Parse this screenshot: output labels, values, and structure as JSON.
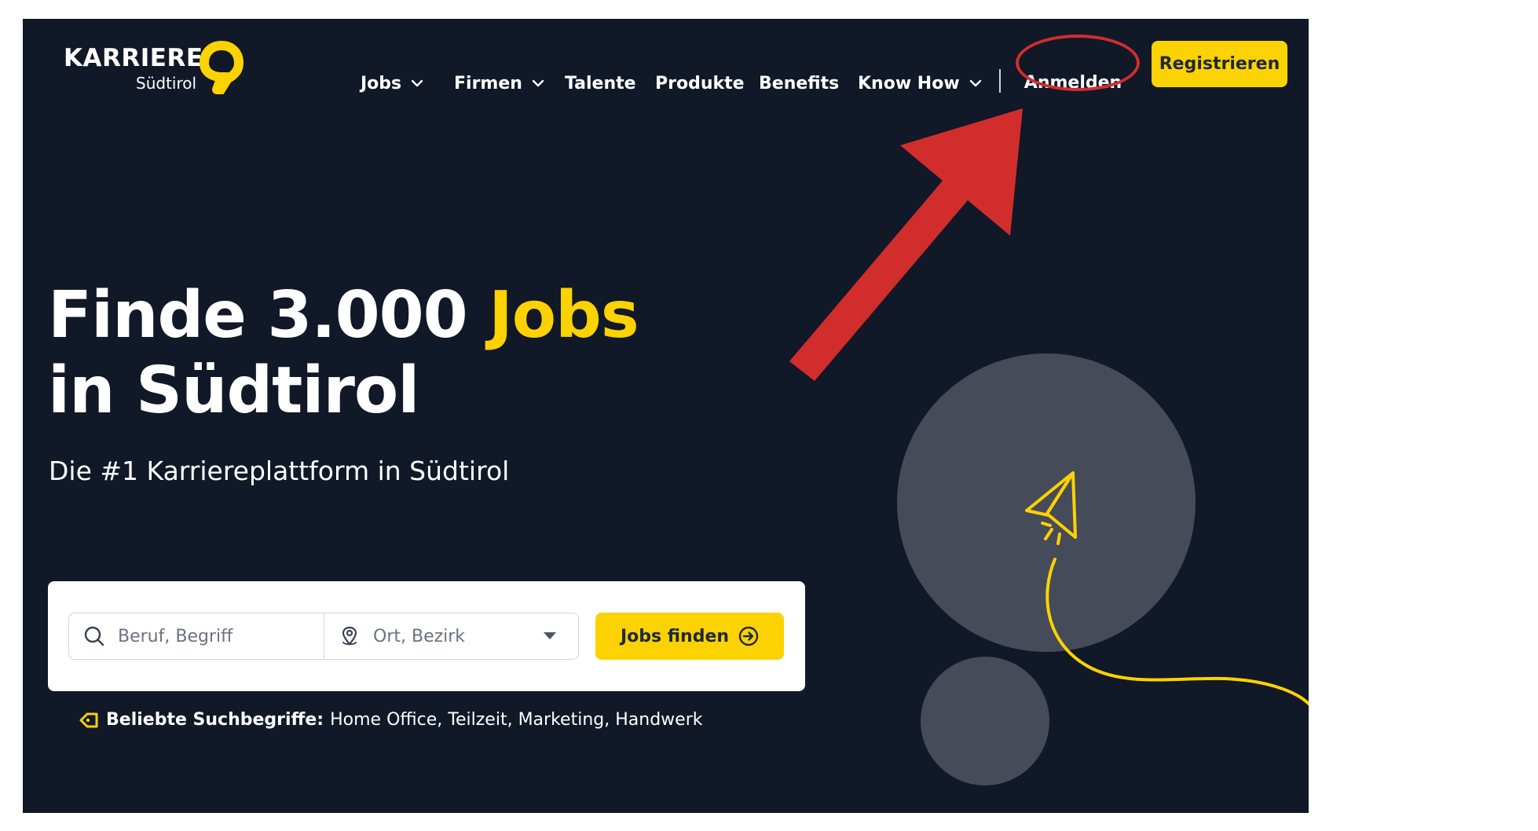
{
  "brand": {
    "name": "KARRIERE",
    "sub": "Südtirol",
    "accent_color": "#fcd200",
    "background_color": "#111827"
  },
  "nav": {
    "items": [
      {
        "label": "Jobs",
        "has_dropdown": true
      },
      {
        "label": "Firmen",
        "has_dropdown": true
      },
      {
        "label": "Talente",
        "has_dropdown": false
      },
      {
        "label": "Produkte",
        "has_dropdown": false
      },
      {
        "label": "Benefits",
        "has_dropdown": false
      },
      {
        "label": "Know How",
        "has_dropdown": true
      }
    ],
    "login_label": "Anmelden",
    "register_label": "Registrieren"
  },
  "hero": {
    "title_part1": "Finde 3.000 ",
    "title_accent": "Jobs",
    "title_line2": "in Südtirol",
    "subtitle": "Die #1 Karriereplattform in Südtirol"
  },
  "search": {
    "what_placeholder": "Beruf, Begriff",
    "where_placeholder": "Ort, Bezirk",
    "button_label": "Jobs finden",
    "popular_label": "Beliebte Suchbegriffe:",
    "popular_terms": [
      "Home Office",
      "Teilzeit",
      "Marketing",
      "Handwerk"
    ]
  },
  "annotation": {
    "highlight_color": "#d12d2d",
    "arrow_color": "#d12d2d"
  }
}
